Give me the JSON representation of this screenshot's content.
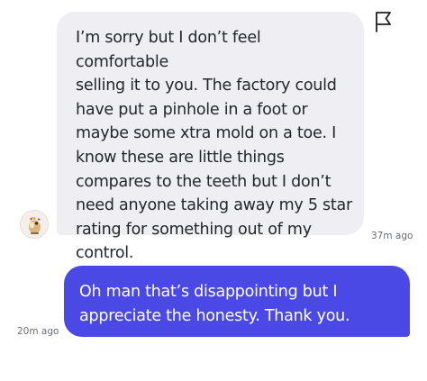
{
  "messages": [
    {
      "direction": "received",
      "lines": [
        "I’m sorry but I don’t feel comfortable",
        "selling it to you. The factory could",
        "have put a pinhole in a foot or",
        "maybe some xtra mold on a toe. I",
        "know these are little things",
        "compares to the teeth but I don’t",
        "need anyone taking away my 5 star",
        "rating for something out of my",
        "control."
      ],
      "time": "37m ago"
    },
    {
      "direction": "sent",
      "lines": [
        "Oh man that’s disappointing but I",
        "appreciate the honesty. Thank you."
      ],
      "time": "20m ago"
    }
  ],
  "icons": {
    "report": "flag-icon",
    "sender_avatar": "avatar"
  },
  "colors": {
    "received_bubble": "#efeff3",
    "sent_bubble": "#4a49e6",
    "timestamp": "#6b6e73"
  }
}
